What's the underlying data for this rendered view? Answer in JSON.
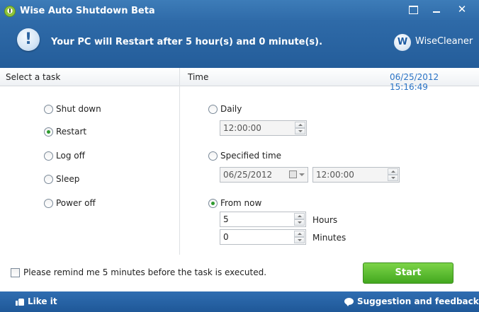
{
  "window": {
    "title": "Wise Auto Shutdown Beta",
    "controls": {
      "minimize": "",
      "maximize": "",
      "close": "✕"
    }
  },
  "banner": {
    "message": "Your PC will Restart after 5 hour(s) and 0 minute(s).",
    "info_icon": "!",
    "brand_logo": "W",
    "brand_name": "WiseCleaner"
  },
  "header": {
    "task_label": "Select a task",
    "time_label": "Time",
    "current_datetime": "06/25/2012 15:16:49"
  },
  "tasks": {
    "options": [
      {
        "label": "Shut down",
        "checked": false
      },
      {
        "label": "Restart",
        "checked": true
      },
      {
        "label": "Log off",
        "checked": false
      },
      {
        "label": "Sleep",
        "checked": false
      },
      {
        "label": "Power off",
        "checked": false
      }
    ]
  },
  "time": {
    "daily": {
      "label": "Daily",
      "checked": false,
      "time": "12:00:00"
    },
    "specified": {
      "label": "Specified time",
      "checked": false,
      "date": "06/25/2012",
      "time": "12:00:00"
    },
    "from_now": {
      "label": "From now",
      "checked": true,
      "hours": "5",
      "hours_unit": "Hours",
      "minutes": "0",
      "minutes_unit": "Minutes"
    }
  },
  "reminder": {
    "label": "Please remind me 5 minutes before the task is executed.",
    "checked": false
  },
  "action_button": {
    "label": "Start"
  },
  "footer": {
    "like": "Like it",
    "feedback": "Suggestion and feedback"
  },
  "colors": {
    "accent_blue": "#2a73c5",
    "brand_green": "#43a81f",
    "title_blue": "#245d9a"
  },
  "icons": [
    "app-clock-icon",
    "info-icon",
    "wisecleaner-logo-icon",
    "like-icon",
    "chat-icon",
    "calendar-icon"
  ]
}
